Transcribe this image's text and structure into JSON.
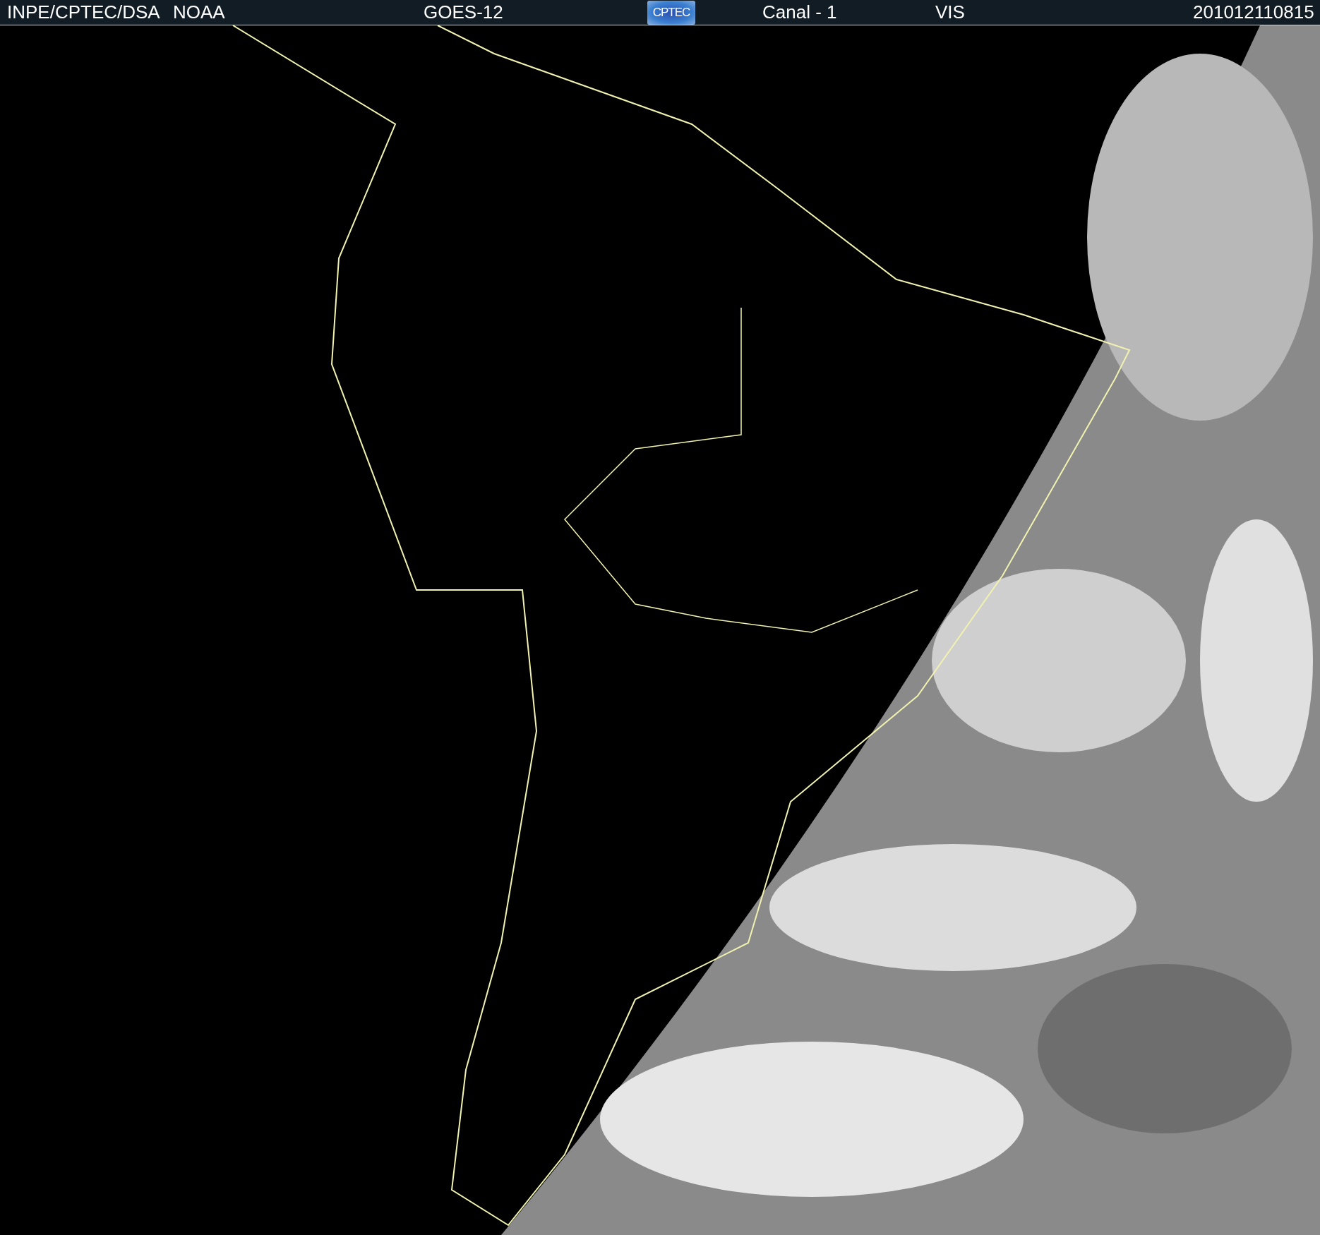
{
  "header": {
    "items": [
      {
        "kind": "text",
        "text": "INPE/CPTEC/DSA"
      },
      {
        "kind": "text",
        "text": "NOAA"
      },
      {
        "kind": "text",
        "text": "GOES-12"
      },
      {
        "kind": "logo",
        "text": "CPTEC"
      },
      {
        "kind": "text",
        "text": "Canal - 1"
      },
      {
        "kind": "text",
        "text": "VIS"
      },
      {
        "kind": "text",
        "text": "201012110815"
      }
    ]
  }
}
